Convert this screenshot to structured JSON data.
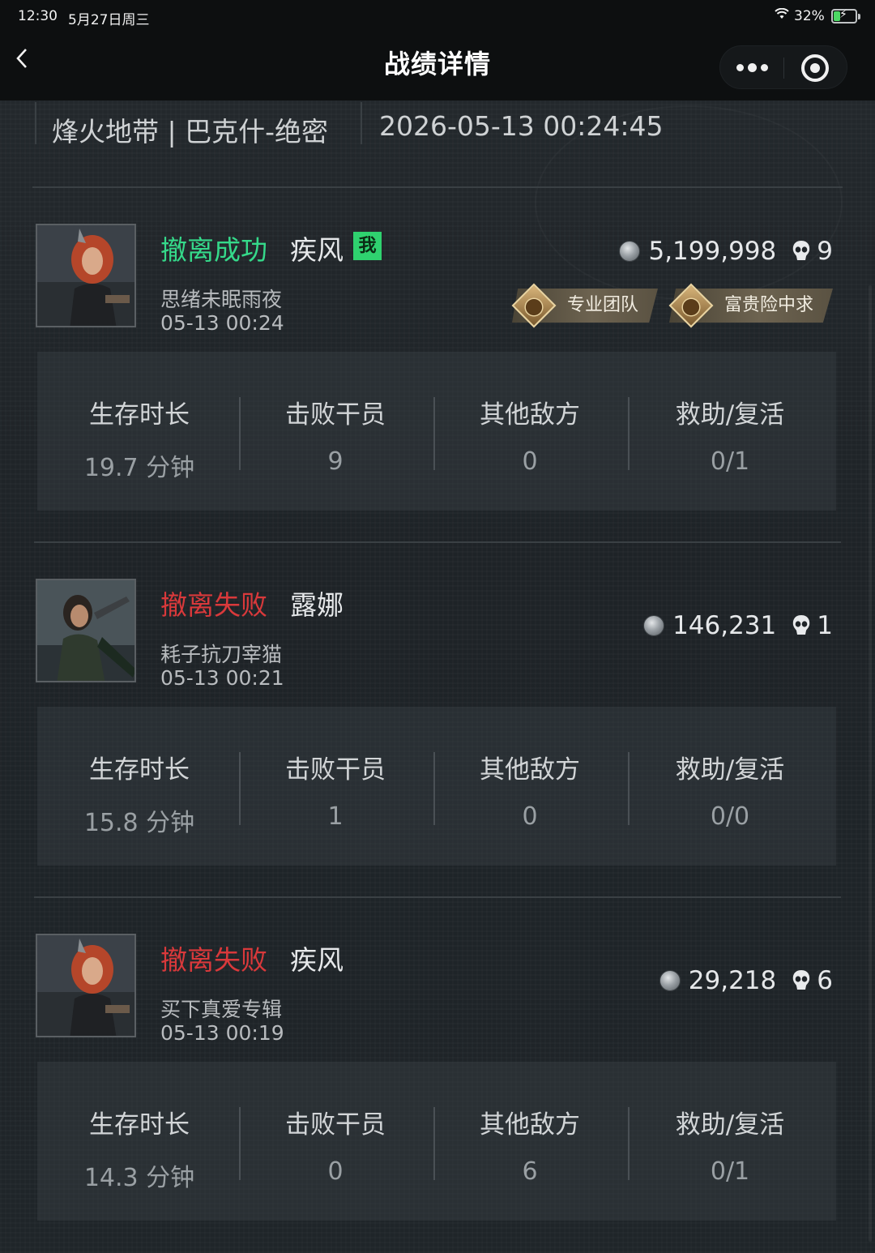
{
  "status_bar": {
    "time": "12:30",
    "date": "5月27日周三",
    "battery_pct": "32%",
    "battery_level": 0.32
  },
  "nav": {
    "title": "战绩详情",
    "back_icon": "chevron-left-icon",
    "more_icon": "more-dots-icon",
    "close_icon": "target-icon"
  },
  "match": {
    "map": "烽火地带 | 巴克什-绝密",
    "datetime": "2026-05-13 00:24:45"
  },
  "stat_labels": {
    "survival": "生存时长",
    "kills": "击败干员",
    "other_enemies": "其他敌方",
    "assist_revive": "救助/复活"
  },
  "players": [
    {
      "status": "撤离成功",
      "status_type": "success",
      "operator": "疾风",
      "is_me": true,
      "me_label": "我",
      "nickname": "思绪未眠雨夜",
      "time": "05-13 00:24",
      "value": "5,199,998",
      "kills": "9",
      "badges": [
        "专业团队",
        "富贵险中求"
      ],
      "stats": {
        "survival": "19.7 分钟",
        "kills": "9",
        "other_enemies": "0",
        "assist_revive": "0/1"
      }
    },
    {
      "status": "撤离失败",
      "status_type": "fail",
      "operator": "露娜",
      "is_me": false,
      "nickname": "耗子抗刀宰猫",
      "time": "05-13 00:21",
      "value": "146,231",
      "kills": "1",
      "badges": [],
      "stats": {
        "survival": "15.8 分钟",
        "kills": "1",
        "other_enemies": "0",
        "assist_revive": "0/0"
      }
    },
    {
      "status": "撤离失败",
      "status_type": "fail",
      "operator": "疾风",
      "is_me": false,
      "nickname": "买下真爱专辑",
      "time": "05-13 00:19",
      "value": "29,218",
      "kills": "6",
      "badges": [],
      "stats": {
        "survival": "14.3 分钟",
        "kills": "0",
        "other_enemies": "6",
        "assist_revive": "0/1"
      }
    }
  ],
  "colors": {
    "success": "#35d98a",
    "fail": "#d9393b",
    "me_badge": "#2fd26f"
  }
}
